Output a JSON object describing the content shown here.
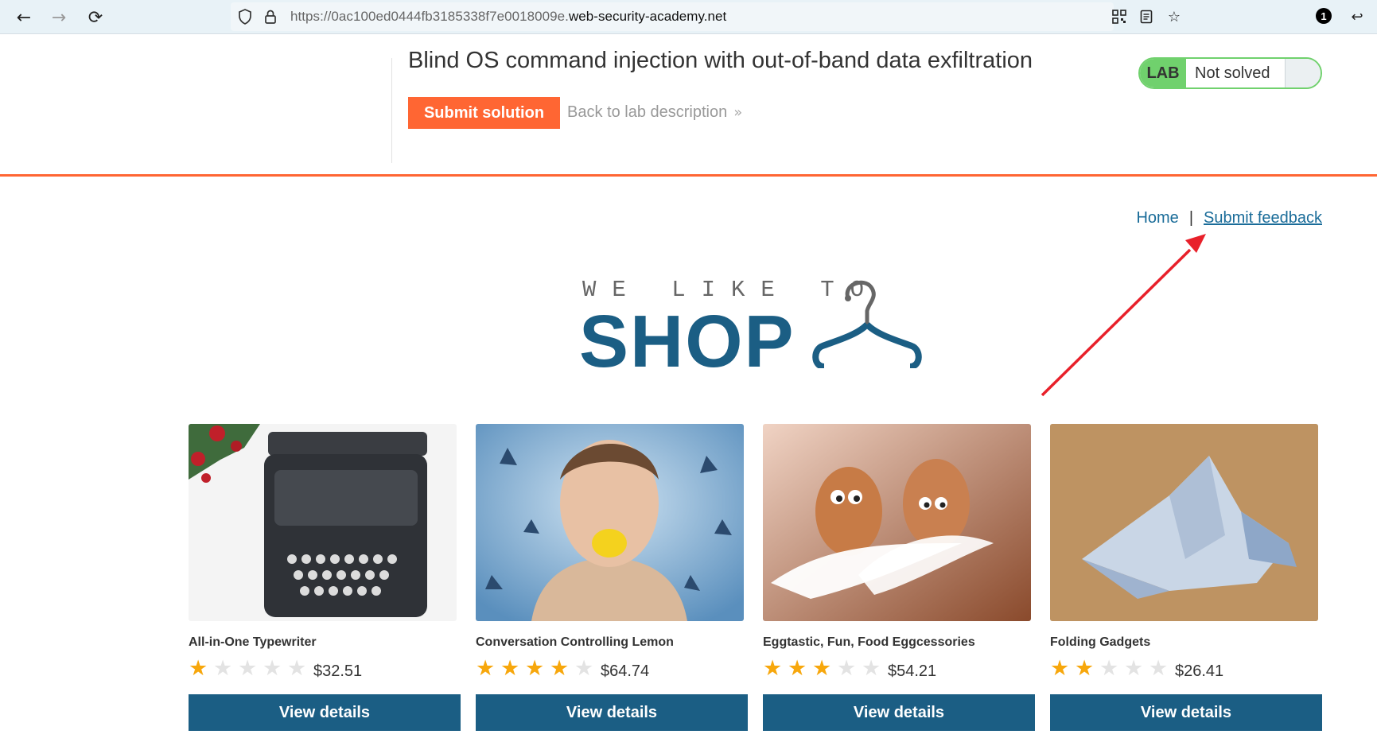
{
  "browser": {
    "url_prefix": "https://0ac100ed0444fb3185338f7e0018009e.",
    "url_domain": "web-security-academy.net",
    "notification_count": "1"
  },
  "lab": {
    "title": "Blind OS command injection with out-of-band data exfiltration",
    "submit_label": "Submit solution",
    "back_label": "Back to lab description",
    "status_tag": "LAB",
    "status_value": "Not solved"
  },
  "nav": {
    "home": "Home",
    "separator": "|",
    "feedback": "Submit feedback"
  },
  "logo": {
    "small_text": "WE LIKE TO",
    "big_text": "SHOP"
  },
  "products": [
    {
      "name": "All-in-One Typewriter",
      "rating": 1,
      "price": "$32.51",
      "button": "View details"
    },
    {
      "name": "Conversation Controlling Lemon",
      "rating": 4,
      "price": "$64.74",
      "button": "View details"
    },
    {
      "name": "Eggtastic, Fun, Food Eggcessories",
      "rating": 3,
      "price": "$54.21",
      "button": "View details"
    },
    {
      "name": "Folding Gadgets",
      "rating": 2,
      "price": "$26.41",
      "button": "View details"
    }
  ],
  "colors": {
    "accent_orange": "#ff6633",
    "brand_blue": "#1b5e84",
    "link_blue": "#1a6c99",
    "lab_green": "#70d16d",
    "star_gold": "#f7a70c",
    "annotation_red": "#e8202a"
  }
}
